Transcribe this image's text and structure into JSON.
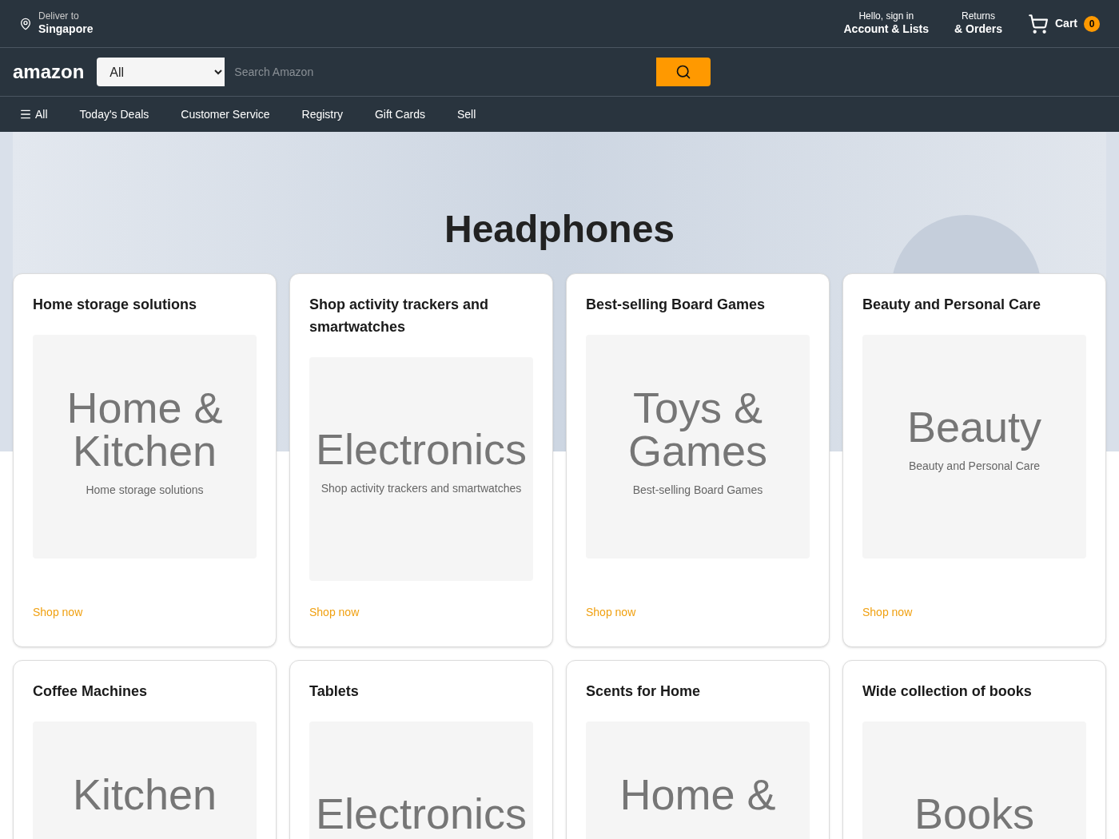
{
  "header": {
    "deliver_label": "Deliver to",
    "deliver_location": "Singapore",
    "account_greeting": "Hello, sign in",
    "account_label": "Account & Lists",
    "returns_label": "Returns",
    "orders_label": "& Orders",
    "cart_label": "Cart",
    "cart_count": "0"
  },
  "search": {
    "logo": "amazon",
    "category": "All",
    "placeholder": "Search Amazon"
  },
  "nav": [
    {
      "label": "All",
      "kind": "menu"
    },
    {
      "label": "Today's Deals",
      "kind": "link"
    },
    {
      "label": "Customer Service",
      "kind": "link"
    },
    {
      "label": "Registry",
      "kind": "link"
    },
    {
      "label": "Gift Cards",
      "kind": "link"
    },
    {
      "label": "Sell",
      "kind": "link"
    }
  ],
  "hero": {
    "title": "Headphones"
  },
  "cards": [
    {
      "title": "Home storage solutions",
      "image": {
        "kind": "two-line",
        "lines": [
          "Home &",
          "Kitchen"
        ],
        "caption": "Home storage solutions"
      },
      "link": "Shop now"
    },
    {
      "title": "Shop activity trackers and smartwatches",
      "image": {
        "kind": "one-line",
        "lines": [
          "Electronics"
        ],
        "caption": "Shop activity trackers and smartwatches"
      },
      "link": "Shop now"
    },
    {
      "title": "Best-selling Board Games",
      "image": {
        "kind": "two-line",
        "lines": [
          "Toys &",
          "Games"
        ],
        "caption": "Best-selling Board Games"
      },
      "link": "Shop now"
    },
    {
      "title": "Beauty and Personal Care",
      "image": {
        "kind": "one-line",
        "lines": [
          "Beauty"
        ],
        "caption": "Beauty and Personal Care"
      },
      "link": "Shop now"
    },
    {
      "title": "Coffee Machines",
      "image": {
        "kind": "two-line",
        "lines": [
          "Kitchen"
        ]
      }
    },
    {
      "title": "Tablets",
      "image": {
        "kind": "one-line",
        "lines": [
          "Electronics"
        ]
      }
    },
    {
      "title": "Scents for Home",
      "image": {
        "kind": "two-line",
        "lines": [
          "Home &"
        ]
      }
    },
    {
      "title": "Wide collection of books",
      "image": {
        "kind": "one-line",
        "lines": [
          "Books"
        ]
      }
    }
  ]
}
